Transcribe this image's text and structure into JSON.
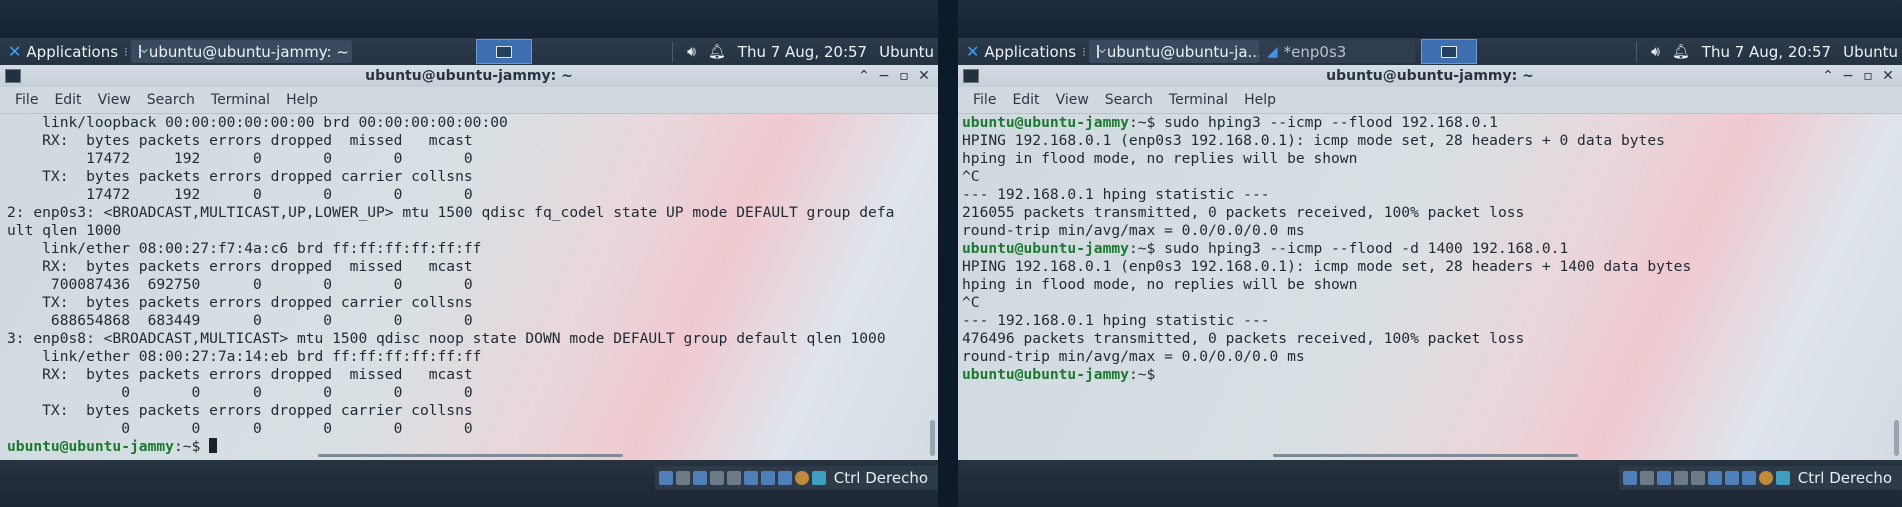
{
  "left": {
    "panel": {
      "apps_label": "Applications",
      "task_label": "ubuntu@ubuntu-jammy: ~",
      "clock": "Thu  7 Aug, 20:57",
      "user": "Ubuntu"
    },
    "window_title": "ubuntu@ubuntu-jammy: ~",
    "menu": [
      "File",
      "Edit",
      "View",
      "Search",
      "Terminal",
      "Help"
    ],
    "output": "    link/loopback 00:00:00:00:00:00 brd 00:00:00:00:00:00\n    RX:  bytes packets errors dropped  missed   mcast\n         17472     192      0       0       0       0\n    TX:  bytes packets errors dropped carrier collsns\n         17472     192      0       0       0       0\n2: enp0s3: <BROADCAST,MULTICAST,UP,LOWER_UP> mtu 1500 qdisc fq_codel state UP mode DEFAULT group defa\nult qlen 1000\n    link/ether 08:00:27:f7:4a:c6 brd ff:ff:ff:ff:ff:ff\n    RX:  bytes packets errors dropped  missed   mcast\n     700087436  692750      0       0       0       0\n    TX:  bytes packets errors dropped carrier collsns\n     688654868  683449      0       0       0       0\n3: enp0s8: <BROADCAST,MULTICAST> mtu 1500 qdisc noop state DOWN mode DEFAULT group default qlen 1000\n    link/ether 08:00:27:7a:14:eb brd ff:ff:ff:ff:ff:ff\n    RX:  bytes packets errors dropped  missed   mcast\n             0       0      0       0       0       0\n    TX:  bytes packets errors dropped carrier collsns\n             0       0      0       0       0       0",
    "prompt": "ubuntu@ubuntu-jammy",
    "prompt_suffix": ":~$ ",
    "status_host_key": "Ctrl Derecho"
  },
  "right": {
    "panel": {
      "apps_label": "Applications",
      "task1_label": "ubuntu@ubuntu-ja...",
      "task2_label": "*enp0s3",
      "clock": "Thu  7 Aug, 20:57",
      "user": "Ubuntu"
    },
    "window_title": "ubuntu@ubuntu-jammy: ~",
    "menu": [
      "File",
      "Edit",
      "View",
      "Search",
      "Terminal",
      "Help"
    ],
    "lines": [
      {
        "prompt": "ubuntu@ubuntu-jammy",
        "text": ":~$ sudo hping3 --icmp --flood 192.168.0.1"
      },
      {
        "text": "HPING 192.168.0.1 (enp0s3 192.168.0.1): icmp mode set, 28 headers + 0 data bytes"
      },
      {
        "text": "hping in flood mode, no replies will be shown"
      },
      {
        "text": "^C"
      },
      {
        "text": "--- 192.168.0.1 hping statistic ---"
      },
      {
        "text": "216055 packets transmitted, 0 packets received, 100% packet loss"
      },
      {
        "text": "round-trip min/avg/max = 0.0/0.0/0.0 ms"
      },
      {
        "prompt": "ubuntu@ubuntu-jammy",
        "text": ":~$ sudo hping3 --icmp --flood -d 1400 192.168.0.1"
      },
      {
        "text": "HPING 192.168.0.1 (enp0s3 192.168.0.1): icmp mode set, 28 headers + 1400 data bytes"
      },
      {
        "text": "hping in flood mode, no replies will be shown"
      },
      {
        "text": "^C"
      },
      {
        "text": "--- 192.168.0.1 hping statistic ---"
      },
      {
        "text": "476496 packets transmitted, 0 packets received, 100% packet loss"
      },
      {
        "text": "round-trip min/avg/max = 0.0/0.0/0.0 ms"
      },
      {
        "prompt": "ubuntu@ubuntu-jammy",
        "text": ":~$"
      }
    ],
    "status_host_key": "Ctrl Derecho"
  }
}
